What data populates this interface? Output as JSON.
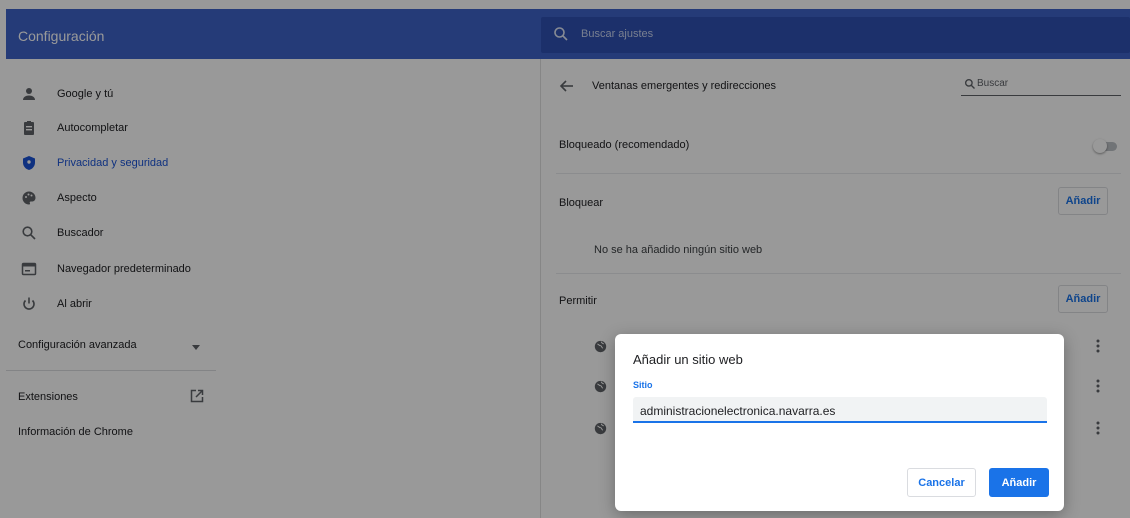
{
  "app": {
    "title": "Configuración",
    "search_placeholder": "Buscar ajustes"
  },
  "sidebar": {
    "items": [
      {
        "label": "Google y tú",
        "icon": "person-icon"
      },
      {
        "label": "Autocompletar",
        "icon": "clipboard-icon"
      },
      {
        "label": "Privacidad y seguridad",
        "icon": "shield-icon",
        "active": true
      },
      {
        "label": "Aspecto",
        "icon": "palette-icon"
      },
      {
        "label": "Buscador",
        "icon": "search-icon"
      },
      {
        "label": "Navegador predeterminado",
        "icon": "browser-icon"
      },
      {
        "label": "Al abrir",
        "icon": "power-icon"
      }
    ],
    "advanced_label": "Configuración avanzada",
    "extensions_label": "Extensiones",
    "about_label": "Información de Chrome"
  },
  "main": {
    "page_title": "Ventanas emergentes y redirecciones",
    "search_placeholder": "Buscar",
    "blocked_label": "Bloqueado (recomendado)",
    "blocked_toggle_on": false,
    "block_section_label": "Bloquear",
    "block_add_label": "Añadir",
    "block_empty": "No se ha añadido ningún sitio web",
    "allow_section_label": "Permitir",
    "allow_add_label": "Añadir"
  },
  "dialog": {
    "title": "Añadir un sitio web",
    "field_label": "Sitio",
    "field_value": "administracionelectronica.navarra.es",
    "cancel_label": "Cancelar",
    "add_label": "Añadir"
  },
  "colors": {
    "header": "#3e63c9",
    "accent": "#1a73e8"
  }
}
